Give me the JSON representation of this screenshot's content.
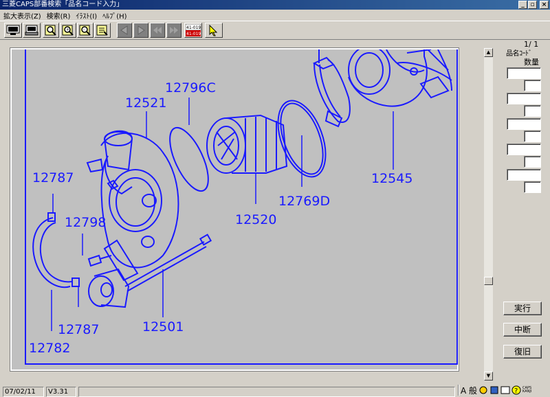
{
  "window": {
    "title": "三菱CAPS部番検索「品名コード入力」"
  },
  "menu": [
    {
      "label": "拡大表示(Z)"
    },
    {
      "label": "検索(R)"
    },
    {
      "label": "ｲﾗｽﾄ(I)"
    },
    {
      "label": "ﾍﾙﾌﾟ(H)"
    }
  ],
  "toolbar": {
    "buttons": [
      {
        "icon": "monitor-icon"
      },
      {
        "icon": "printer-icon"
      },
      {
        "icon": "magnify-icon"
      },
      {
        "icon": "zoom-in-icon"
      },
      {
        "icon": "zoom-out-icon"
      },
      {
        "icon": "edit-icon"
      },
      {
        "icon": "prev-icon"
      },
      {
        "icon": "next-icon"
      },
      {
        "icon": "first-icon"
      },
      {
        "icon": "last-icon"
      },
      {
        "icon": "number-icon",
        "text_top": "41-019",
        "text_bot": "41-019"
      },
      {
        "icon": "pointer-icon"
      }
    ]
  },
  "drawing": {
    "part_labels": [
      {
        "text": "12796C"
      },
      {
        "text": "12521"
      },
      {
        "text": "12787"
      },
      {
        "text": "12798"
      },
      {
        "text": "12520"
      },
      {
        "text": "12769D"
      },
      {
        "text": "12545"
      },
      {
        "text": "12787"
      },
      {
        "text": "12501"
      },
      {
        "text": "12782"
      }
    ]
  },
  "right_panel": {
    "page": "1/ 1",
    "code_label": "品名ｺｰﾄﾞ",
    "qty_label": "数量",
    "execute": "実行",
    "interrupt": "中断",
    "restore": "復旧"
  },
  "status": {
    "date": "07/02/11",
    "version": "V3.31",
    "message": ""
  },
  "tray": {
    "ime_mode": "A 般",
    "caps_label": "CAPS KANJI"
  },
  "colors": {
    "line": "#1a1aff",
    "canvas": "#c0c0c0",
    "titlebar": "#0a246a"
  }
}
